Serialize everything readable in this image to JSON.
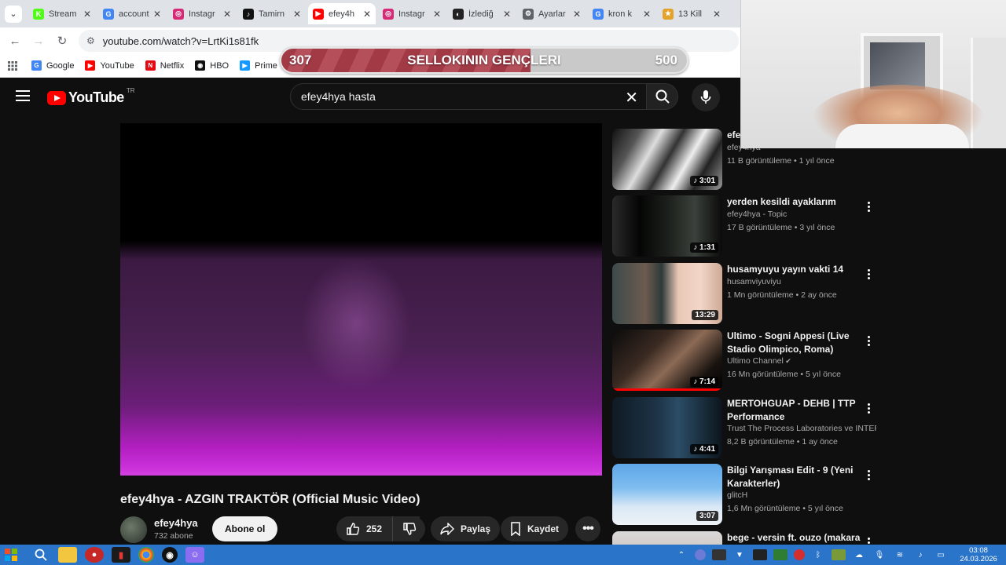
{
  "browser": {
    "tabs": [
      {
        "label": "Stream",
        "icon": "kick-icon",
        "color": "#53fc18",
        "glyph": "K"
      },
      {
        "label": "account",
        "icon": "google-icon",
        "color": "#4285f4",
        "glyph": "G"
      },
      {
        "label": "Instagr",
        "icon": "instagram-icon",
        "color": "#d62976",
        "glyph": "◎"
      },
      {
        "label": "Tamirn",
        "icon": "tiktok-icon",
        "color": "#111111",
        "glyph": "♪"
      },
      {
        "label": "efey4h",
        "icon": "youtube-icon",
        "color": "#ff0000",
        "glyph": "▶",
        "active": true
      },
      {
        "label": "Instagr",
        "icon": "instagram-icon",
        "color": "#d62976",
        "glyph": "◎"
      },
      {
        "label": "İzlediğ",
        "icon": "tracker-icon",
        "color": "#222222",
        "glyph": "◐"
      },
      {
        "label": "Ayarlar",
        "icon": "gear-icon",
        "color": "#5f6368",
        "glyph": "⚙"
      },
      {
        "label": "kron k",
        "icon": "google-icon",
        "color": "#4285f4",
        "glyph": "G"
      },
      {
        "label": "13 Kill",
        "icon": "game-icon",
        "color": "#e3a32b",
        "glyph": "★"
      }
    ],
    "url": "youtube.com/watch?v=LrtKi1s81fk",
    "bookmarks": [
      {
        "label": "Google",
        "icon": "google-icon",
        "color": "#4285f4",
        "glyph": "G"
      },
      {
        "label": "YouTube",
        "icon": "youtube-icon",
        "color": "#ff0000",
        "glyph": "▶"
      },
      {
        "label": "Netflix",
        "icon": "netflix-icon",
        "color": "#e50914",
        "glyph": "N"
      },
      {
        "label": "HBO",
        "icon": "hbo-icon",
        "color": "#111111",
        "glyph": "◉"
      },
      {
        "label": "Prime",
        "icon": "prime-icon",
        "color": "#1399ff",
        "glyph": "▶"
      }
    ]
  },
  "overlay": {
    "left_value": "307",
    "title": "SELLOKININ GENÇLERI",
    "right_value": "500",
    "progress_fraction": 0.614
  },
  "youtube": {
    "logo_text": "YouTube",
    "country_code": "TR",
    "search_value": "efey4hya hasta",
    "video": {
      "title": "efey4hya - AZGIN TRAKTÖR (Official Music Video)",
      "channel": "efey4hya",
      "subscribers": "732 abone",
      "subscribe_label": "Abone ol",
      "likes": "252",
      "share_label": "Paylaş",
      "save_label": "Kaydet"
    },
    "recommendations": [
      {
        "title": "efe… (Official Music Video)",
        "channel": "efey4hya",
        "meta": "11 B görüntüleme • 1 yıl önce",
        "duration": "3:01",
        "music": true,
        "thumb": "bw"
      },
      {
        "title": "yerden kesildi ayaklarım",
        "channel": "efey4hya - Topic",
        "meta": "17 B görüntüleme • 3 yıl önce",
        "duration": "1:31",
        "music": true,
        "thumb": "dark"
      },
      {
        "title": "husamyuyu yayın vakti 14",
        "channel": "husamviyuviyu",
        "meta": "1 Mn görüntüleme • 2 ay önce",
        "duration": "13:29",
        "music": false,
        "thumb": "faces"
      },
      {
        "title": "Ultimo - Sogni Appesi (Live Stadio Olimpico, Roma)",
        "channel": "Ultimo Channel",
        "meta": "16 Mn görüntüleme • 5 yıl önce",
        "duration": "7:14",
        "music": true,
        "thumb": "concert",
        "verified": true
      },
      {
        "title": "MERTOHGUAP - DEHB | TTP Performance",
        "channel": "Trust The Process Laboratories ve INTER…",
        "meta": "8,2 B görüntüleme • 1 ay önce",
        "duration": "4:41",
        "music": true,
        "thumb": "studio"
      },
      {
        "title": "Bilgi Yarışması Edit - 9 (Yeni Karakterler)",
        "channel": "glitcH",
        "meta": "1,6 Mn görüntüleme • 5 yıl önce",
        "duration": "3:07",
        "music": false,
        "thumb": "quiz"
      },
      {
        "title": "bege - versin ft. ouzo (makara",
        "channel": "",
        "meta": "",
        "duration": "",
        "music": false,
        "thumb": "face"
      }
    ]
  },
  "taskbar": {
    "clock_time": "03:08",
    "clock_date": "24.03.2026"
  }
}
